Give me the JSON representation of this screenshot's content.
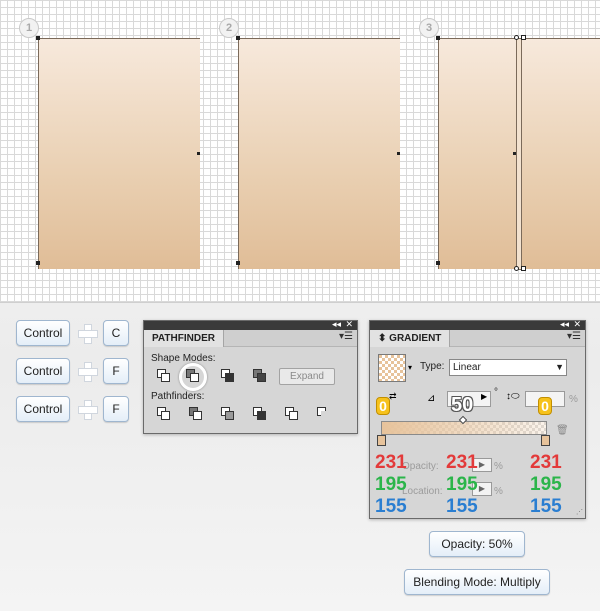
{
  "steps": [
    "1",
    "2",
    "3"
  ],
  "keys": {
    "row1": {
      "modifier": "Control",
      "key": "C"
    },
    "row2": {
      "modifier": "Control",
      "key": "F"
    },
    "row3": {
      "modifier": "Control",
      "key": "F"
    }
  },
  "pathfinder": {
    "title": "PATHFINDER",
    "shape_modes_label": "Shape Modes:",
    "pathfinders_label": "Pathfinders:",
    "expand_label": "Expand"
  },
  "gradient": {
    "title": "GRADIENT",
    "type_label": "Type:",
    "type_value": "Linear",
    "angle_value": "0",
    "aspect_value": "50",
    "percent_sign": "%",
    "degree_sign": "°",
    "opacity_label": "Opacity:",
    "location_label": "Location:",
    "stop_left_badge": "0",
    "stop_right_badge": "0",
    "colors": [
      {
        "r": "231",
        "g": "195",
        "b": "155"
      },
      {
        "r": "231",
        "g": "195",
        "b": "155"
      },
      {
        "r": "231",
        "g": "195",
        "b": "155"
      }
    ]
  },
  "settings": {
    "opacity_text": "Opacity: 50%",
    "blending_text": "Blending Mode: Multiply"
  },
  "palette": {
    "fill_top": "#f7e9dc",
    "fill_bottom": "#e0bd97",
    "red": "#e33a3a",
    "green": "#2bb54a",
    "blue": "#2a7ed1",
    "badge": "#f6c21c"
  }
}
